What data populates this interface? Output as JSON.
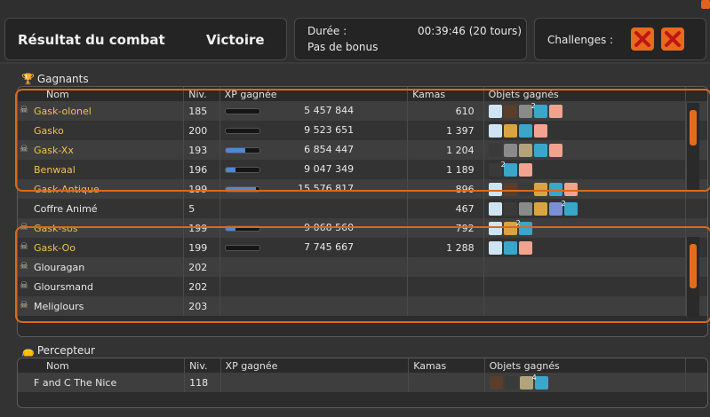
{
  "header": {
    "title": "Résultat du combat",
    "result": "Victoire",
    "duration_label": "Durée :",
    "duration_value": "00:39:46 (20 tours)",
    "bonus": "Pas de bonus",
    "challenges_label": "Challenges :",
    "challenge_icons": [
      "challenge-failed-icon",
      "challenge-failed-icon"
    ],
    "accent_color": "#e66b1b"
  },
  "columns": {
    "name": "Nom",
    "level": "Niv.",
    "xp": "XP gagnée",
    "kamas": "Kamas",
    "items": "Objets gagnés"
  },
  "winners": {
    "title": "Gagnants",
    "rows": [
      {
        "name": "Gask-olonel",
        "level": "185",
        "xp": "5 457 844",
        "xp_progress": 0.0,
        "kamas": "610",
        "color": "gold",
        "skull": true,
        "items": [
          {
            "c": "#cfe4f2"
          },
          {
            "c": "#5a3d2a"
          },
          {
            "c": "#8a8a8a"
          },
          {
            "c": "#3aa6c9",
            "q": "2"
          },
          {
            "c": "#f2a38f"
          }
        ]
      },
      {
        "name": "Gasko",
        "level": "200",
        "xp": "9 523 651",
        "xp_progress": 0.0,
        "kamas": "1 397",
        "color": "gold",
        "skull": false,
        "items": [
          {
            "c": "#cfe4f2"
          },
          {
            "c": "#d9a441"
          },
          {
            "c": "#3aa6c9"
          },
          {
            "c": "#f2a38f"
          }
        ]
      },
      {
        "name": "Gask-Xx",
        "level": "193",
        "xp": "6 854 447",
        "xp_progress": 0.6,
        "kamas": "1 204",
        "color": "gold",
        "skull": true,
        "items": [
          {
            "c": "#3a3a3a"
          },
          {
            "c": "#8a8a8a"
          },
          {
            "c": "#b3a37a"
          },
          {
            "c": "#3aa6c9"
          },
          {
            "c": "#f2a38f"
          }
        ]
      },
      {
        "name": "Benwaal",
        "level": "196",
        "xp": "9 047 349",
        "xp_progress": 0.3,
        "kamas": "1 189",
        "color": "gold",
        "skull": false,
        "items": [
          {
            "c": "#3a3a3a"
          },
          {
            "c": "#3aa6c9",
            "q": "2"
          },
          {
            "c": "#f2a38f"
          }
        ]
      },
      {
        "name": "Gask-Antique",
        "level": "199",
        "xp": "15 576 817",
        "xp_progress": 0.9,
        "kamas": "896",
        "color": "gold",
        "skull": false,
        "items": [
          {
            "c": "#cfe4f2"
          },
          {
            "c": "#5a3d2a"
          },
          {
            "c": "#3a3a3a"
          },
          {
            "c": "#d9a441"
          },
          {
            "c": "#3aa6c9"
          },
          {
            "c": "#f2a38f"
          }
        ]
      },
      {
        "name": "Coffre Animé",
        "level": "5",
        "xp": "",
        "xp_progress": null,
        "kamas": "467",
        "color": "white",
        "skull": false,
        "items": [
          {
            "c": "#cfe4f2"
          },
          {
            "c": "#3a3a3a"
          },
          {
            "c": "#8a8a8a"
          },
          {
            "c": "#d9a441"
          },
          {
            "c": "#7a8fd6"
          },
          {
            "c": "#3aa6c9",
            "q": "2"
          }
        ]
      },
      {
        "name": "Gask-sos",
        "level": "199",
        "xp": "9 068 560",
        "xp_progress": 0.3,
        "kamas": "792",
        "color": "gold",
        "skull": true,
        "items": [
          {
            "c": "#cfe4f2"
          },
          {
            "c": "#d9a441"
          },
          {
            "c": "#3aa6c9",
            "q": "2"
          }
        ]
      },
      {
        "name": "Gask-Oo",
        "level": "199",
        "xp": "7 745 667",
        "xp_progress": 0.0,
        "kamas": "1 288",
        "color": "gold",
        "skull": true,
        "items": [
          {
            "c": "#cfe4f2"
          },
          {
            "c": "#3aa6c9"
          },
          {
            "c": "#f2a38f"
          }
        ]
      },
      {
        "name": "Glouragan",
        "level": "202",
        "xp": "",
        "xp_progress": null,
        "kamas": "",
        "color": "white",
        "skull": true,
        "items": []
      },
      {
        "name": "Gloursmand",
        "level": "202",
        "xp": "",
        "xp_progress": null,
        "kamas": "",
        "color": "white",
        "skull": true,
        "items": []
      },
      {
        "name": "Meliglours",
        "level": "203",
        "xp": "",
        "xp_progress": null,
        "kamas": "",
        "color": "white",
        "skull": true,
        "items": []
      }
    ]
  },
  "collector": {
    "title": "Percepteur",
    "rows": [
      {
        "name": "F and C The Nice",
        "level": "118",
        "xp": "",
        "xp_progress": null,
        "kamas": "",
        "color": "white",
        "skull": false,
        "items": [
          {
            "c": "#5a3d2a"
          },
          {
            "c": "#3a3a3a"
          },
          {
            "c": "#b3a37a"
          },
          {
            "c": "#3aa6c9",
            "q": "4"
          }
        ]
      }
    ]
  }
}
